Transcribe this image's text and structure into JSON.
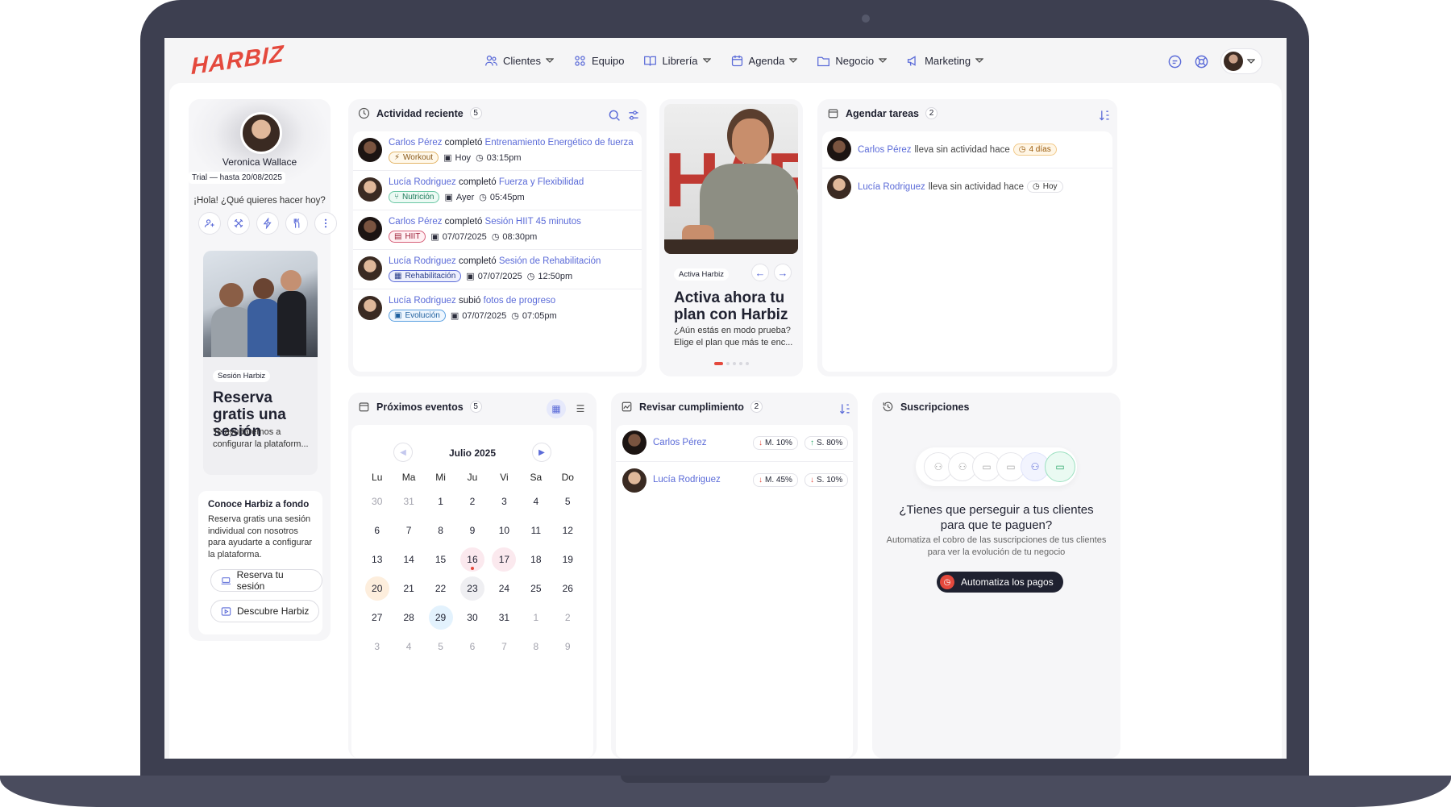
{
  "brand": {
    "logo": "HARBIZ",
    "accent": "#e4493d",
    "link": "#5b6bd8"
  },
  "nav": [
    {
      "label": "Clientes",
      "icon": "users-icon",
      "dropdown": true
    },
    {
      "label": "Equipo",
      "icon": "team-icon",
      "dropdown": false
    },
    {
      "label": "Librería",
      "icon": "book-icon",
      "dropdown": true
    },
    {
      "label": "Agenda",
      "icon": "calendar-icon",
      "dropdown": true
    },
    {
      "label": "Negocio",
      "icon": "folder-icon",
      "dropdown": true
    },
    {
      "label": "Marketing",
      "icon": "megaphone-icon",
      "dropdown": true
    }
  ],
  "profile": {
    "name": "Veronica Wallace",
    "trial": "Trial — hasta 20/08/2025",
    "greeting": "¡Hola! ¿Qué quieres hacer hoy?"
  },
  "session_card": {
    "tag": "Sesión Harbiz",
    "title": "Reserva gratis una sesión",
    "desc": "Te ayudaremos a configurar la plataform..."
  },
  "learn_card": {
    "title": "Conoce Harbiz a fondo",
    "desc": "Reserva gratis una sesión individual con nosotros para ayudarte a configurar la plataforma.",
    "btn1": "Reserva tu sesión",
    "btn2": "Descubre Harbiz"
  },
  "activity": {
    "title": "Actividad reciente",
    "count": "5",
    "items": [
      {
        "name": "Carlos Pérez",
        "verb": "completó",
        "target": "Entrenamiento Energético de fuerza",
        "tag": "Workout",
        "date": "Hoy",
        "time": "03:15pm"
      },
      {
        "name": "Lucía Rodriguez",
        "verb": "completó",
        "target": "Fuerza y Flexibilidad",
        "tag": "Nutrición",
        "date": "Ayer",
        "time": "05:45pm"
      },
      {
        "name": "Carlos Pérez",
        "verb": "completó",
        "target": "Sesión HIIT 45 minutos",
        "tag": "HIIT",
        "date": "07/07/2025",
        "time": "08:30pm"
      },
      {
        "name": "Lucía Rodriguez",
        "verb": "completó",
        "target": "Sesión de Rehabilitación",
        "tag": "Rehabilitación",
        "date": "07/07/2025",
        "time": "12:50pm"
      },
      {
        "name": "Lucía Rodriguez",
        "verb": "subió",
        "target": "fotos de progreso",
        "tag": "Evolución",
        "date": "07/07/2025",
        "time": "07:05pm"
      }
    ]
  },
  "promo": {
    "tag": "Activa Harbiz",
    "title": "Activa ahora tu plan con Harbiz",
    "desc": "¿Aún estás en modo prueba? Elige el plan que más te enc..."
  },
  "tasks": {
    "title": "Agendar tareas",
    "count": "2",
    "items": [
      {
        "name": "Carlos Pérez",
        "text": "lleva sin actividad hace",
        "badge": "4 días"
      },
      {
        "name": "Lucía Rodriguez",
        "text": "lleva sin actividad hace",
        "badge": "Hoy"
      }
    ]
  },
  "events": {
    "title": "Próximos eventos",
    "count": "5",
    "month": "Julio 2025",
    "weekdays": [
      "Lu",
      "Ma",
      "Mi",
      "Ju",
      "Vi",
      "Sa",
      "Do"
    ],
    "days": [
      "30",
      "31",
      "1",
      "2",
      "3",
      "4",
      "5",
      "6",
      "7",
      "8",
      "9",
      "10",
      "11",
      "12",
      "13",
      "14",
      "15",
      "16",
      "17",
      "18",
      "19",
      "20",
      "21",
      "22",
      "23",
      "24",
      "25",
      "26",
      "27",
      "28",
      "29",
      "30",
      "31",
      "1",
      "2",
      "3",
      "4",
      "5",
      "6",
      "7",
      "8",
      "9"
    ]
  },
  "compliance": {
    "title": "Revisar cumplimiento",
    "count": "2",
    "items": [
      {
        "name": "Carlos Pérez",
        "m": "M. 10%",
        "s": "S. 80%"
      },
      {
        "name": "Lucía Rodriguez",
        "m": "M. 45%",
        "s": "S. 10%"
      }
    ]
  },
  "subs": {
    "title": "Suscripciones",
    "question": "¿Tienes que perseguir a tus clientes para que te paguen?",
    "desc": "Automatiza el cobro de las suscripciones de tus clientes para ver la evolución de tu negocio",
    "button": "Automatiza los pagos"
  }
}
